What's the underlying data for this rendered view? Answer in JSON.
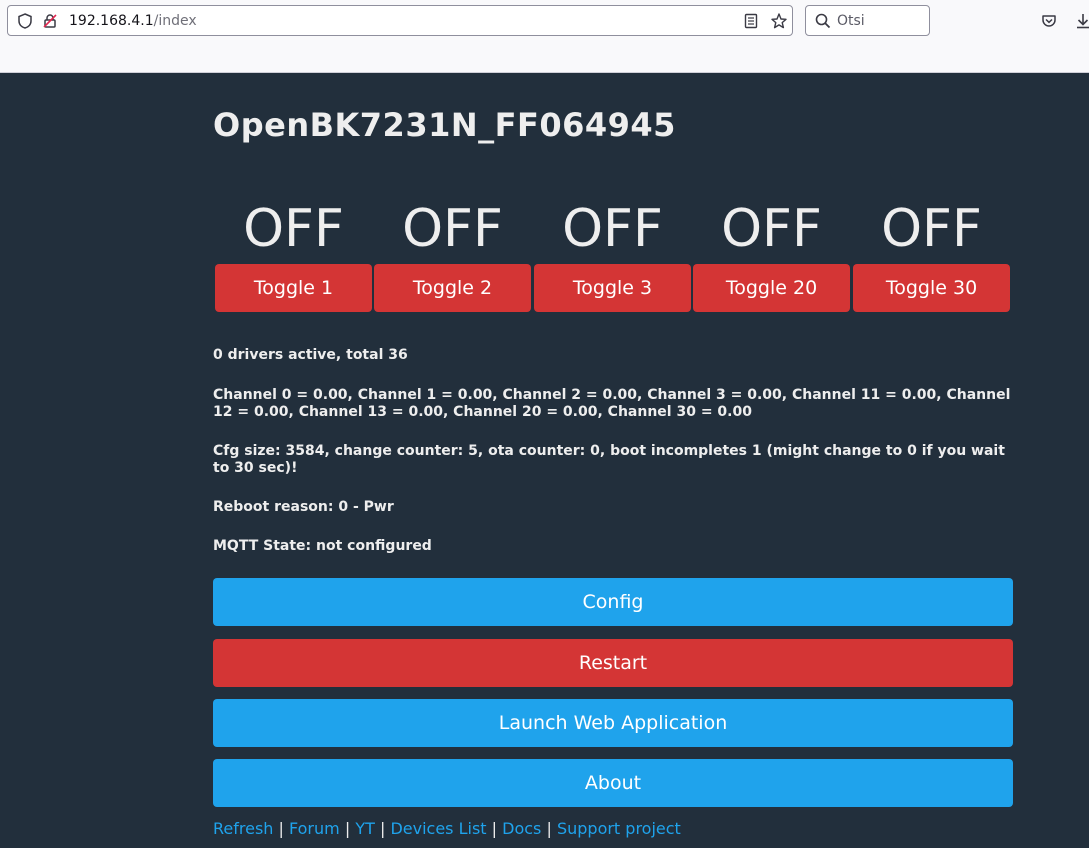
{
  "browser": {
    "url_host": "192.168.4.1",
    "url_path": "/index",
    "search_placeholder": "Otsi"
  },
  "page": {
    "title": "OpenBK7231N_FF064945"
  },
  "toggles": [
    {
      "state": "OFF",
      "label": "Toggle 1"
    },
    {
      "state": "OFF",
      "label": "Toggle 2"
    },
    {
      "state": "OFF",
      "label": "Toggle 3"
    },
    {
      "state": "OFF",
      "label": "Toggle 20"
    },
    {
      "state": "OFF",
      "label": "Toggle 30"
    }
  ],
  "info": {
    "drivers": "0 drivers active, total 36",
    "channels": "Channel 0 = 0.00, Channel 1 = 0.00, Channel 2 = 0.00, Channel 3 = 0.00, Channel 11 = 0.00, Channel 12 = 0.00, Channel 13 = 0.00, Channel 20 = 0.00, Channel 30 = 0.00",
    "cfg": "Cfg size: 3584, change counter: 5, ota counter: 0, boot incompletes 1 (might change to 0 if you wait to 30 sec)!",
    "reboot": "Reboot reason: 0 - Pwr",
    "mqtt": "MQTT State: not configured"
  },
  "buttons": {
    "config": "Config",
    "restart": "Restart",
    "launch": "Launch Web Application",
    "about": "About"
  },
  "footer": {
    "refresh": "Refresh",
    "forum": "Forum",
    "yt": "YT",
    "devices": "Devices List",
    "docs": "Docs",
    "support": "Support project",
    "separator": "|"
  },
  "colors": {
    "background": "#222f3c",
    "accent_blue": "#1fa3ec",
    "accent_red": "#d43535",
    "text": "#eeeeee"
  }
}
